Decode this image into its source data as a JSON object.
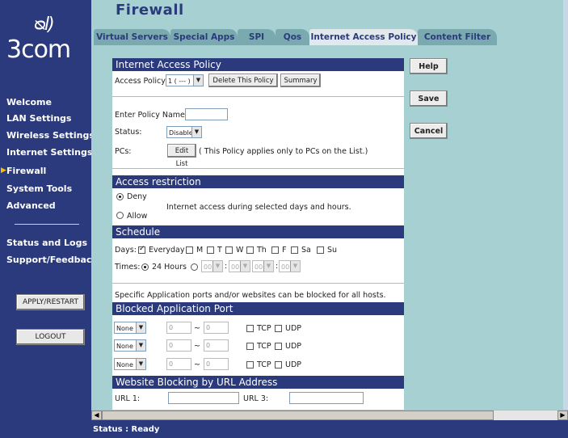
{
  "brand": {
    "name": "3com"
  },
  "header": {
    "title": "Firewall"
  },
  "tabs": [
    {
      "label": "Virtual Servers"
    },
    {
      "label": "Special Apps"
    },
    {
      "label": "SPI"
    },
    {
      "label": "Qos"
    },
    {
      "label": "Internet Access Policy",
      "active": true
    },
    {
      "label": "Content Filter"
    }
  ],
  "sidebar": {
    "items": [
      {
        "label": "Welcome"
      },
      {
        "label": "LAN Settings"
      },
      {
        "label": "Wireless Settings"
      },
      {
        "label": "Internet Settings"
      },
      {
        "label": "Firewall",
        "current": true
      },
      {
        "label": "System Tools"
      },
      {
        "label": "Advanced"
      },
      {
        "label": "Status and Logs"
      },
      {
        "label": "Support/Feedback"
      }
    ],
    "apply_label": "APPLY/RESTART",
    "logout_label": "LOGOUT"
  },
  "right_buttons": {
    "help": "Help",
    "save": "Save",
    "cancel": "Cancel"
  },
  "policy": {
    "heading": "Internet Access Policy",
    "access_policy_label": "Access Policy:",
    "access_policy_value": "1 ( --- )",
    "delete_label": "Delete This Policy",
    "summary_label": "Summary",
    "name_label": "Enter Policy Name:",
    "name_value": "",
    "status_label": "Status:",
    "status_value": "Disabled",
    "pcs_label": "PCs:",
    "edit_list_label": "Edit List",
    "pcs_note": "( This Policy applies only to PCs on the List.)"
  },
  "restriction": {
    "heading": "Access restriction",
    "deny_label": "Deny",
    "allow_label": "Allow",
    "description": "Internet access during selected days and hours.",
    "selected": "Deny"
  },
  "schedule": {
    "heading": "Schedule",
    "days_label": "Days:",
    "days": [
      {
        "label": "Everyday",
        "checked": true
      },
      {
        "label": "M",
        "checked": false
      },
      {
        "label": "T",
        "checked": false
      },
      {
        "label": "W",
        "checked": false
      },
      {
        "label": "Th",
        "checked": false
      },
      {
        "label": "F",
        "checked": false
      },
      {
        "label": "Sa",
        "checked": false
      },
      {
        "label": "Su",
        "checked": false
      }
    ],
    "times_label": "Times:",
    "all_hours_label": "24 Hours",
    "time_values": [
      "00",
      "00",
      "00",
      "00"
    ],
    "time_sep": ":"
  },
  "blocked_note": "Specific Application ports and/or websites can be blocked for all hosts.",
  "blocked_ports": {
    "heading": "Blocked Application Port",
    "rows": [
      {
        "service": "None",
        "from": "0",
        "to": "0",
        "tcp": "TCP",
        "udp": "UDP"
      },
      {
        "service": "None",
        "from": "0",
        "to": "0",
        "tcp": "TCP",
        "udp": "UDP"
      },
      {
        "service": "None",
        "from": "0",
        "to": "0",
        "tcp": "TCP",
        "udp": "UDP"
      }
    ],
    "range_sep": "~"
  },
  "url_blocking": {
    "heading": "Website Blocking by URL Address",
    "url1_label": "URL 1:",
    "url3_label": "URL 3:",
    "url1_value": "",
    "url3_value": ""
  },
  "status": {
    "text": "Status : Ready"
  },
  "colors": {
    "navy": "#2a3a7c",
    "teal": "#a6d0d2",
    "tab": "#7aaab0"
  }
}
